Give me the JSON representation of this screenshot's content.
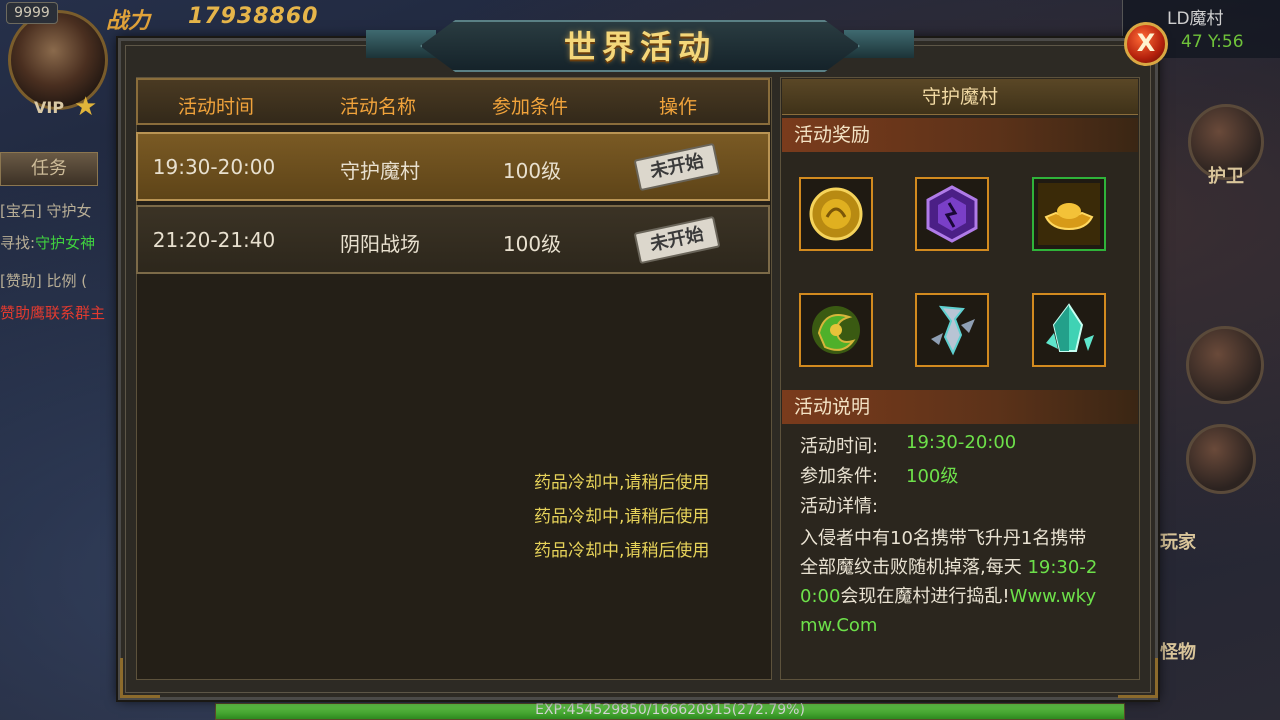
{
  "hud": {
    "level_badge": "9999",
    "vip": "VIP",
    "power_label": "战力",
    "power_value": "17938860",
    "task_tab": "任务",
    "lines": [
      {
        "parts": [
          {
            "t": "[宝石] 守护女",
            "c": "b"
          }
        ]
      },
      {
        "parts": [
          {
            "t": "寻找:",
            "c": "b"
          },
          {
            "t": "守护女神",
            "c": "g"
          }
        ]
      },
      {
        "parts": [
          {
            "t": "[赞助] 比例 (",
            "c": "b"
          }
        ]
      },
      {
        "parts": [
          {
            "t": "赞助鹰联系群主",
            "c": "r"
          }
        ]
      }
    ],
    "location_name": "LD魔村",
    "location_coords": "47 Y:56",
    "side_guard": "护卫",
    "side_player": "玩家",
    "side_monster": "怪物",
    "exp_text": "EXP:454529850/166620915(272.79%)",
    "exp_fill_pct": 100
  },
  "dialog": {
    "title": "世界活动",
    "close_label": "X",
    "table": {
      "headers": [
        "活动时间",
        "活动名称",
        "参加条件",
        "操作"
      ],
      "rows": [
        {
          "time": "19:30-20:00",
          "name": "守护魔村",
          "cond": "100级",
          "action": "未开始",
          "selected": true
        },
        {
          "time": "21:20-21:40",
          "name": "阴阳战场",
          "cond": "100级",
          "action": "未开始",
          "selected": false
        }
      ]
    },
    "toasts": [
      "药品冷却中,请稍后使用",
      "药品冷却中,请稍后使用",
      "药品冷却中,请稍后使用"
    ],
    "detail": {
      "title": "守护魔村",
      "reward_header": "活动奖励",
      "rewards": [
        {
          "icon": "gold-coin-icon",
          "color": "#e0b020",
          "border": "orange"
        },
        {
          "icon": "purple-gem-icon",
          "color": "#7a3fc8",
          "border": "orange"
        },
        {
          "icon": "gold-ingot-icon",
          "color": "#e0a51a",
          "border": "green"
        },
        {
          "icon": "green-swirl-icon",
          "color": "#4fb02a",
          "border": "orange"
        },
        {
          "icon": "silver-shard-icon",
          "color": "#b8c4d4",
          "border": "orange"
        },
        {
          "icon": "crystal-shard-icon",
          "color": "#3fd2b4",
          "border": "orange"
        }
      ],
      "desc_header": "活动说明",
      "time_label": "活动时间:",
      "time_value": "19:30-20:00",
      "cond_label": "参加条件:",
      "cond_value": "100级",
      "detail_label": "活动详情:",
      "desc_text_1": "入侵者中有10名携带飞升丹1名携带全部魔纹击败随机掉落,每天 ",
      "desc_time": "19:30-20:00",
      "desc_text_2": "会现在魔村进行捣乱!",
      "desc_url": "Www.wkymw.Com"
    }
  }
}
